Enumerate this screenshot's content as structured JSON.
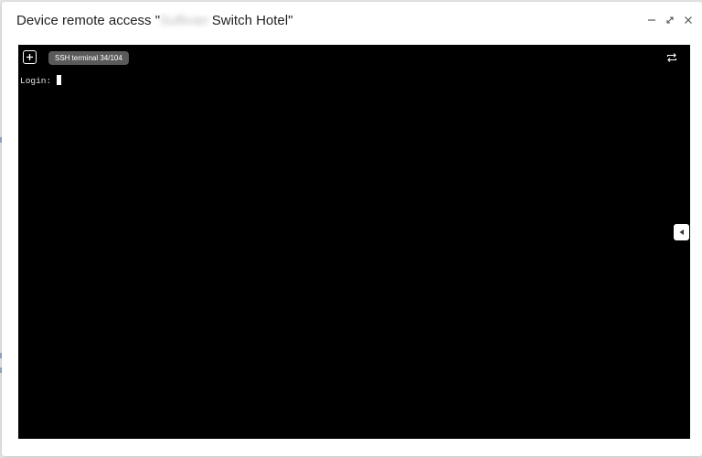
{
  "dialog": {
    "title_prefix": "Device remote access \"",
    "title_redacted": "Sullivan",
    "title_suffix": " Switch Hotel\"",
    "controls": {
      "minimize_icon": "minimize-icon",
      "expand_icon": "expand-icon",
      "close_icon": "close-icon"
    }
  },
  "terminal": {
    "new_terminal_icon": "plus-box-icon",
    "tab_label": "SSH terminal 34/104",
    "reconnect_icon": "swap-arrows-icon",
    "prompt": "Login: ",
    "side_toggle_icon": "triangle-left-icon"
  },
  "colors": {
    "terminal_bg": "#000000",
    "terminal_text": "#e6e6e6",
    "tab_bg": "#5a5a5a",
    "dialog_bg": "#ffffff"
  }
}
